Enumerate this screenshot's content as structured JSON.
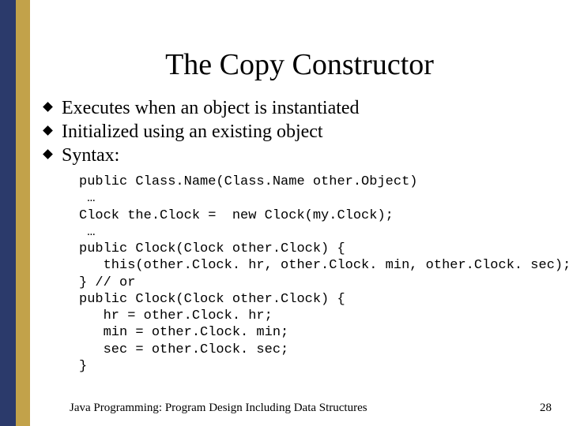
{
  "title": "The Copy Constructor",
  "bullets": [
    "Executes when an object is instantiated",
    "Initialized using an existing object",
    "Syntax:"
  ],
  "code_lines": [
    "public Class.Name(Class.Name other.Object)",
    " …",
    "Clock the.Clock =  new Clock(my.Clock);",
    " …",
    "public Clock(Clock other.Clock) {",
    "   this(other.Clock. hr, other.Clock. min, other.Clock. sec);",
    "} // or",
    "public Clock(Clock other.Clock) {",
    "   hr = other.Clock. hr;",
    "   min = other.Clock. min;",
    "   sec = other.Clock. sec;",
    "}"
  ],
  "footer": {
    "left": "Java Programming: Program Design Including Data Structures",
    "right": "28"
  }
}
